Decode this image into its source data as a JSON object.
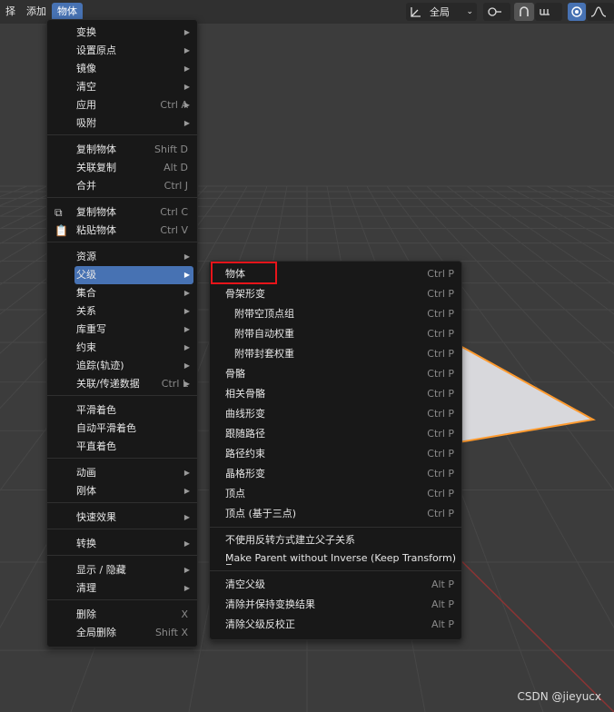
{
  "header": {
    "menus": [
      "择",
      "添加",
      "物体"
    ],
    "transform_orientation": "全局",
    "icons": [
      "transform-pivot-icon",
      "snap-link-icon",
      "magnet-icon",
      "snap-target-icon",
      "proportional-edit-icon",
      "falloff-curve-icon"
    ]
  },
  "object_menu": {
    "items": [
      {
        "label": "变换",
        "shortcut": "",
        "submenu": true
      },
      {
        "label": "设置原点",
        "shortcut": "",
        "submenu": true
      },
      {
        "label": "镜像",
        "shortcut": "",
        "submenu": true
      },
      {
        "label": "清空",
        "shortcut": "",
        "submenu": true
      },
      {
        "label": "应用",
        "shortcut": "Ctrl A",
        "submenu": true
      },
      {
        "label": "吸附",
        "shortcut": "",
        "submenu": true
      },
      {
        "label": "复制物体",
        "shortcut": "Shift D",
        "submenu": false
      },
      {
        "label": "关联复制",
        "shortcut": "Alt D",
        "submenu": false
      },
      {
        "label": "合并",
        "shortcut": "Ctrl J",
        "submenu": false
      },
      {
        "label": "复制物体",
        "shortcut": "Ctrl C",
        "submenu": false,
        "icon": "copy-icon"
      },
      {
        "label": "粘贴物体",
        "shortcut": "Ctrl V",
        "submenu": false,
        "icon": "paste-icon"
      },
      {
        "label": "资源",
        "shortcut": "",
        "submenu": true
      },
      {
        "label": "父级",
        "shortcut": "",
        "submenu": true,
        "selected": true
      },
      {
        "label": "集合",
        "shortcut": "",
        "submenu": true
      },
      {
        "label": "关系",
        "shortcut": "",
        "submenu": true
      },
      {
        "label": "库重写",
        "shortcut": "",
        "submenu": true
      },
      {
        "label": "约束",
        "shortcut": "",
        "submenu": true
      },
      {
        "label": "追踪(轨迹)",
        "shortcut": "",
        "submenu": true
      },
      {
        "label": "关联/传递数据",
        "shortcut": "Ctrl L",
        "submenu": true
      },
      {
        "label": "平滑着色",
        "shortcut": "",
        "submenu": false
      },
      {
        "label": "自动平滑着色",
        "shortcut": "",
        "submenu": false
      },
      {
        "label": "平直着色",
        "shortcut": "",
        "submenu": false
      },
      {
        "label": "动画",
        "shortcut": "",
        "submenu": true
      },
      {
        "label": "刚体",
        "shortcut": "",
        "submenu": true
      },
      {
        "label": "快速效果",
        "shortcut": "",
        "submenu": true
      },
      {
        "label": "转换",
        "shortcut": "",
        "submenu": true
      },
      {
        "label": "显示 / 隐藏",
        "shortcut": "",
        "submenu": true
      },
      {
        "label": "清理",
        "shortcut": "",
        "submenu": true
      },
      {
        "label": "删除",
        "shortcut": "X",
        "submenu": false
      },
      {
        "label": "全局删除",
        "shortcut": "Shift X",
        "submenu": false
      }
    ]
  },
  "parent_submenu": {
    "items": [
      {
        "label": "物体",
        "shortcut": "Ctrl P"
      },
      {
        "label": "骨架形变",
        "shortcut": "Ctrl P"
      },
      {
        "label": "附带空顶点组",
        "shortcut": "Ctrl P"
      },
      {
        "label": "附带自动权重",
        "shortcut": "Ctrl P"
      },
      {
        "label": "附带封套权重",
        "shortcut": "Ctrl P"
      },
      {
        "label": "骨骼",
        "shortcut": "Ctrl P"
      },
      {
        "label": "相关骨骼",
        "shortcut": "Ctrl P"
      },
      {
        "label": "曲线形变",
        "shortcut": "Ctrl P"
      },
      {
        "label": "跟随路径",
        "shortcut": "Ctrl P"
      },
      {
        "label": "路径约束",
        "shortcut": "Ctrl P"
      },
      {
        "label": "晶格形变",
        "shortcut": "Ctrl P"
      },
      {
        "label": "顶点",
        "shortcut": "Ctrl P"
      },
      {
        "label": "顶点 (基于三点)",
        "shortcut": "Ctrl P"
      },
      {
        "label": "不使用反转方式建立父子关系",
        "shortcut": ""
      },
      {
        "label": "Make Parent without Inverse (Keep Transform)",
        "shortcut": ""
      },
      {
        "label": "清空父级",
        "shortcut": "Alt P"
      },
      {
        "label": "清除并保持变换结果",
        "shortcut": "Alt P"
      },
      {
        "label": "清除父级反校正",
        "shortcut": "Alt P"
      }
    ]
  },
  "watermark": "CSDN @jieyucx",
  "colors": {
    "accent": "#4772b3",
    "menu_bg": "#181818",
    "highlight": "#e8141a",
    "plane_fill": "#d8d8dc",
    "plane_outline": "#ff9a2e"
  }
}
